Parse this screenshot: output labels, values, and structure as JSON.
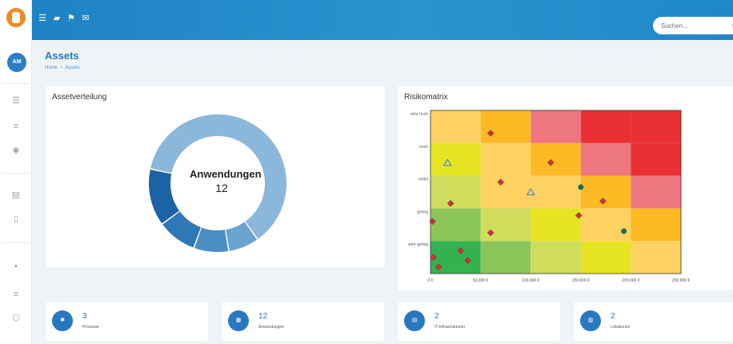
{
  "header": {
    "search_placeholder": "Suchen...",
    "menu_icon": "menu-icon",
    "icons": [
      "book-icon",
      "flag-icon",
      "mail-icon"
    ]
  },
  "sidebar": {
    "avatar": "AM",
    "icons": [
      "list-icon",
      "list-detail-icon",
      "gear-icon",
      "document-icon",
      "book-icon",
      "chat-icon",
      "checklist-icon",
      "shield-icon"
    ]
  },
  "page": {
    "title": "Assets",
    "breadcrumb": [
      "Home",
      "Assets"
    ]
  },
  "donut_card": {
    "title": "Assetverteilung",
    "center_label": "Anwendungen",
    "center_value": "12"
  },
  "matrix_card": {
    "title": "Risikomatrix"
  },
  "stats": [
    {
      "value": "3",
      "label": "Prozesse",
      "icon": "gear-icon"
    },
    {
      "value": "12",
      "label": "Anwendungen",
      "icon": "grid-icon"
    },
    {
      "value": "2",
      "label": "IT-Infrastrukturen",
      "icon": "server-icon"
    },
    {
      "value": "2",
      "label": "Lokationen",
      "icon": "building-icon"
    }
  ],
  "colors": {
    "brand": "#2878c0",
    "topbar": "#1e82c4",
    "donut": [
      "#8ab7da",
      "#6aa3cf",
      "#4b8ec4",
      "#2f78b6",
      "#1c63a5"
    ],
    "heat": {
      "green_dark": "#34b24f",
      "green": "#8cc65a",
      "yellow_green": "#cfdc5c",
      "yellow": "#e6e421",
      "light_orange": "#fdd262",
      "orange": "#fbb924",
      "pink": "#ee7680",
      "red": "#ea3033"
    }
  },
  "chart_data": [
    {
      "type": "pie",
      "variant": "donut",
      "title": "Assetverteilung",
      "slices": [
        {
          "name": "Anwendungen",
          "value": 12
        },
        {
          "value": 1.4
        },
        {
          "value": 1.6
        },
        {
          "value": 1.8
        },
        {
          "value": 2.6
        }
      ],
      "center_label": "Anwendungen",
      "center_value": 12
    },
    {
      "type": "heatmap",
      "title": "Risikomatrix",
      "x_ticks": [
        "0 €",
        "50.000 €",
        "100.000 €",
        "150.000 €",
        "200.000 €",
        "250.000 €"
      ],
      "y_ticks": [
        "sehr gering",
        "gering",
        "mittel",
        "hoch",
        "sehr hoch"
      ],
      "xlim": [
        0,
        250000
      ],
      "grid": [
        [
          "green_dark",
          "green",
          "yellow_green",
          "yellow",
          "light_orange"
        ],
        [
          "green",
          "yellow_green",
          "yellow",
          "light_orange",
          "orange"
        ],
        [
          "yellow_green",
          "light_orange",
          "light_orange",
          "orange",
          "pink"
        ],
        [
          "yellow",
          "light_orange",
          "orange",
          "pink",
          "red"
        ],
        [
          "light_orange",
          "orange",
          "pink",
          "red",
          "red"
        ]
      ],
      "series": [
        {
          "marker": "diamond",
          "points": [
            [
              3000,
              0.5
            ],
            [
              8000,
              0.2
            ],
            [
              30000,
              0.7
            ],
            [
              37000,
              0.4
            ],
            [
              60000,
              1.25
            ],
            [
              2000,
              1.6
            ],
            [
              20000,
              2.15
            ],
            [
              70000,
              2.8
            ],
            [
              120000,
              3.4
            ],
            [
              60000,
              4.3
            ],
            [
              148000,
              1.78
            ],
            [
              172000,
              2.22
            ]
          ]
        },
        {
          "marker": "triangle",
          "points": [
            [
              17000,
              3.4
            ],
            [
              100000,
              2.5
            ]
          ]
        },
        {
          "marker": "circle",
          "points": [
            [
              150000,
              2.65
            ],
            [
              193000,
              1.3
            ]
          ]
        }
      ]
    }
  ]
}
